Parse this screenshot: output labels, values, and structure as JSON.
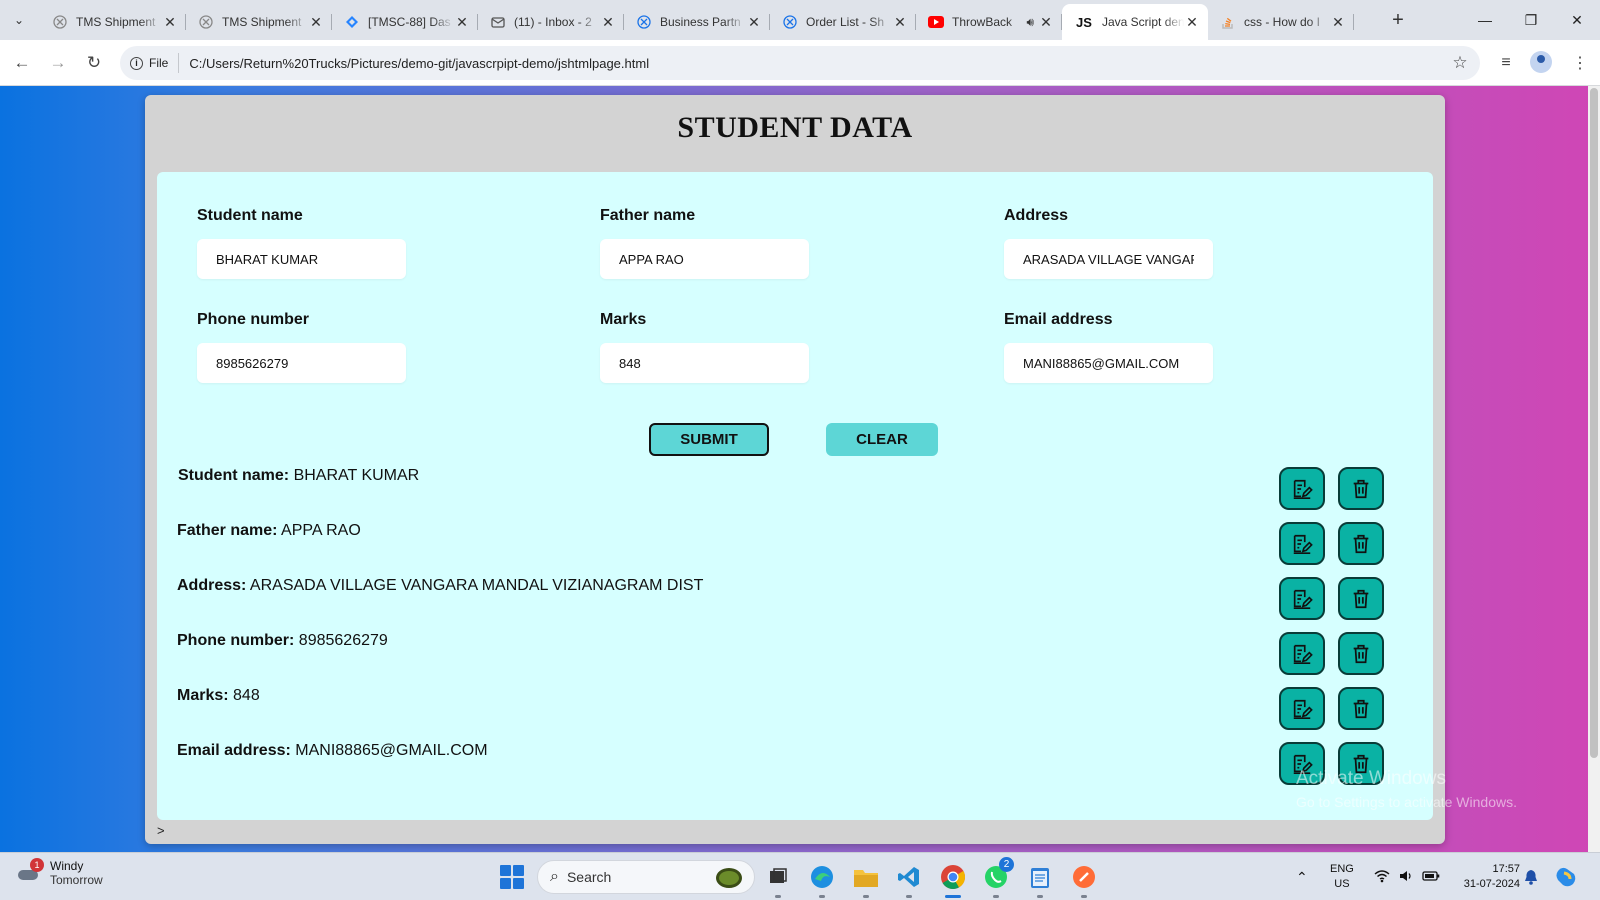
{
  "browser": {
    "tabs": [
      {
        "title": "TMS Shipment",
        "icon": "brand-circle-icon"
      },
      {
        "title": "TMS Shipment",
        "icon": "brand-circle-icon"
      },
      {
        "title": "[TMSC-88] Das",
        "icon": "jira-icon"
      },
      {
        "title": "(11) - Inbox - 2",
        "icon": "mail-icon"
      },
      {
        "title": "Business Partn",
        "icon": "brand-circle-icon"
      },
      {
        "title": "Order List - Sh",
        "icon": "brand-circle-icon"
      },
      {
        "title": "ThrowBack",
        "icon": "youtube-icon"
      },
      {
        "title": "Java Script den",
        "icon": "js-icon"
      },
      {
        "title": "css - How do I",
        "icon": "stackoverflow-icon"
      }
    ],
    "active_tab_index": 7,
    "address_chip": "File",
    "url": "C:/Users/Return%20Trucks/Pictures/demo-git/javascrpipt-demo/jshtmlpage.html"
  },
  "page": {
    "title": "STUDENT DATA",
    "form": {
      "student_name": {
        "label": "Student name",
        "value": "BHARAT KUMAR"
      },
      "father_name": {
        "label": "Father name",
        "value": "APPA RAO"
      },
      "address": {
        "label": "Address",
        "value": "ARASADA VILLAGE VANGARA MANDAL VIZIANAGRAM DIST"
      },
      "phone": {
        "label": "Phone number",
        "value": "8985626279"
      },
      "marks": {
        "label": "Marks",
        "value": "848"
      },
      "email": {
        "label": "Email address",
        "value": "MANI88865@GMAIL.COM"
      }
    },
    "submit_label": "SUBMIT",
    "clear_label": "CLEAR",
    "records": [
      {
        "key": "Student name:",
        "value": "BHARAT KUMAR"
      },
      {
        "key": "Father name:",
        "value": "APPA RAO"
      },
      {
        "key": "Address:",
        "value": "ARASADA VILLAGE VANGARA MANDAL VIZIANAGRAM DIST"
      },
      {
        "key": "Phone number:",
        "value": "8985626279"
      },
      {
        "key": "Marks:",
        "value": "848"
      },
      {
        "key": "Email address:",
        "value": "MANI88865@GMAIL.COM"
      }
    ],
    "prompt": ">"
  },
  "watermark": {
    "line1": "Activate Windows",
    "line2": "Go to Settings to activate Windows."
  },
  "taskbar": {
    "weather_title": "Windy",
    "weather_sub": "Tomorrow",
    "weather_badge": "1",
    "search_placeholder": "Search",
    "whatsapp_badge": "2",
    "lang_line1": "ENG",
    "lang_line2": "US",
    "time": "17:57",
    "date": "31-07-2024"
  },
  "colors": {
    "panel": "#d6ffff",
    "card": "#d3d3d3",
    "button": "#5dd6d6",
    "action_button": "#0ab2a4"
  }
}
